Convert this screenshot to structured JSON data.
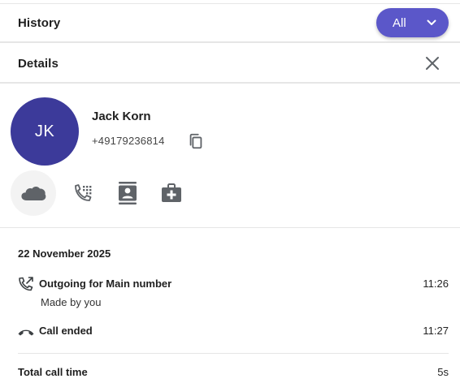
{
  "colors": {
    "accent": "#5b57c9",
    "avatar_bg": "#3c3a9a",
    "divider": "#e6e6e6",
    "icon": "#5f6368"
  },
  "history_bar": {
    "title": "History",
    "filter": {
      "selected": "All",
      "icon": "chevron-down-icon"
    }
  },
  "details_bar": {
    "title": "Details",
    "close_icon": "close-icon"
  },
  "contact": {
    "initials": "JK",
    "name": "Jack Korn",
    "phone": "+49179236814",
    "copy_icon": "copy-icon"
  },
  "actions": [
    {
      "icon": "salesforce-cloud-icon"
    },
    {
      "icon": "dialpad-call-icon"
    },
    {
      "icon": "contact-card-icon"
    },
    {
      "icon": "medical-kit-icon"
    }
  ],
  "log": {
    "date": "22 November 2025",
    "events": [
      {
        "icon": "outgoing-call-icon",
        "title": "Outgoing for Main number",
        "subtitle": "Made by you",
        "time": "11:26"
      },
      {
        "icon": "call-ended-icon",
        "title": "Call ended",
        "time": "11:27"
      }
    ],
    "total_label": "Total call time",
    "total_value": "5s"
  }
}
